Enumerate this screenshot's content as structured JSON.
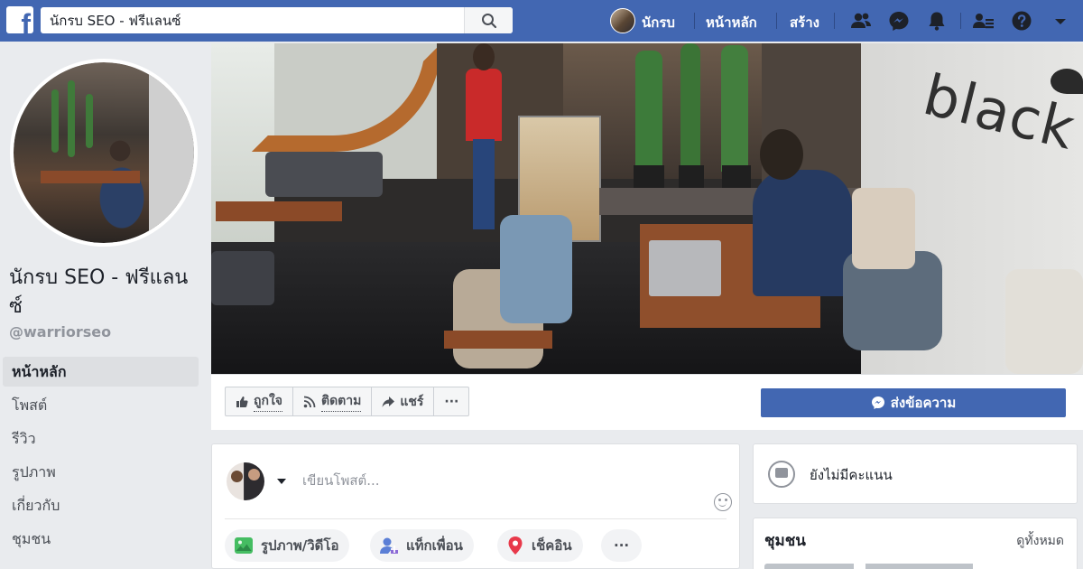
{
  "topbar": {
    "search_value": "นักรบ SEO - ฟรีแลนซ์",
    "user_name": "นักรบ",
    "home_label": "หน้าหลัก",
    "create_label": "สร้าง",
    "brand_color": "#4267b2"
  },
  "page": {
    "name": "นักรบ SEO - ฟรีแลนซ์",
    "handle": "@warriorseo",
    "cover_wall_text": "black"
  },
  "sidebar": {
    "items": [
      {
        "label": "หน้าหลัก",
        "active": true
      },
      {
        "label": "โพสต์",
        "active": false
      },
      {
        "label": "รีวิว",
        "active": false
      },
      {
        "label": "รูปภาพ",
        "active": false
      },
      {
        "label": "เกี่ยวกับ",
        "active": false
      },
      {
        "label": "ชุมชน",
        "active": false
      }
    ]
  },
  "actions": {
    "like_label": "ถูกใจ",
    "follow_label": "ติดตาม",
    "share_label": "แชร์",
    "more_label": "···",
    "message_label": "ส่งข้อความ"
  },
  "composer": {
    "placeholder": "เขียนโพสต์...",
    "photo_label": "รูปภาพ/วิดีโอ",
    "tag_label": "แท็กเพื่อน",
    "checkin_label": "เช็คอิน",
    "more_label": "···"
  },
  "rating": {
    "text": "ยังไม่มีคะแนน"
  },
  "community": {
    "title": "ชุมชน",
    "see_all": "ดูทั้งหมด"
  },
  "icons": {
    "search": "search-icon",
    "friends": "friends-icon",
    "messenger": "messenger-icon",
    "notifications": "bell-icon",
    "friend_requests": "friend-requests-icon",
    "help": "help-icon",
    "account": "caret-down-icon"
  }
}
